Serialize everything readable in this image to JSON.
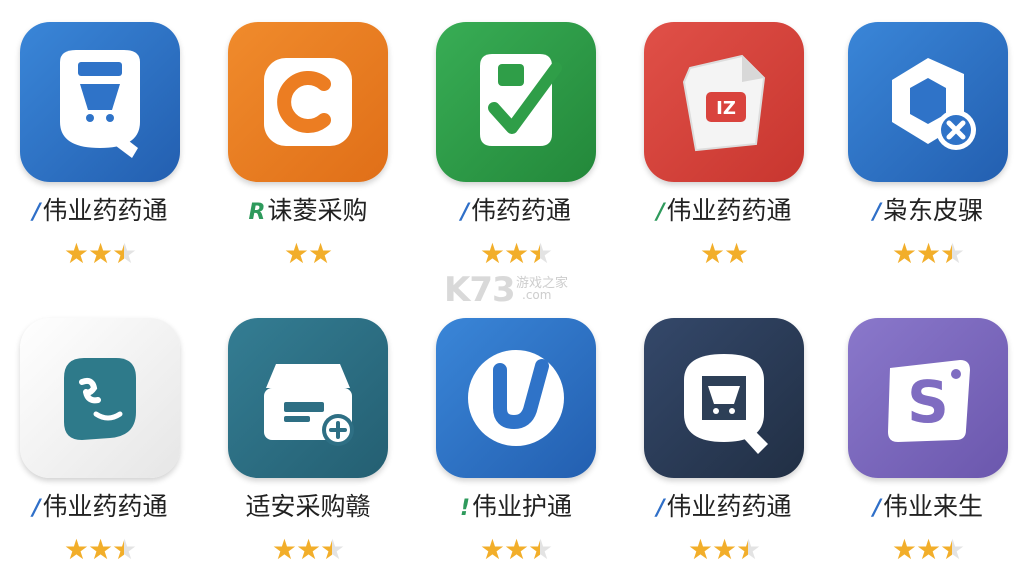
{
  "apps": [
    {
      "name": "伟业药药通",
      "mark": "/",
      "mark_color": "#2f6fc8",
      "rating": 2.5,
      "icon": "q-bag-icon",
      "bg": "#2f73c8"
    },
    {
      "name": "诔菱采购",
      "mark": "R",
      "mark_color": "#2e9a5c",
      "rating": 2,
      "icon": "c-letter-icon",
      "bg": "#ec7d22"
    },
    {
      "name": "伟药药通",
      "mark": "/",
      "mark_color": "#2f6fc8",
      "rating": 2.5,
      "icon": "bag-check-icon",
      "bg": "#2f9e48"
    },
    {
      "name": "伟业药药通",
      "mark": "/",
      "mark_color": "#2e9a5c",
      "rating": 2,
      "icon": "cube-tag-icon",
      "bg": "#d9433d"
    },
    {
      "name": "枭东皮骒",
      "mark": "/",
      "mark_color": "#2f6fc8",
      "rating": 2.5,
      "icon": "q-plus-icon",
      "bg": "#2f73c8"
    },
    {
      "name": "伟业药药通",
      "mark": "/",
      "mark_color": "#2f6fc8",
      "rating": 2.5,
      "icon": "speech-face-icon",
      "bg": "#f2f2f2"
    },
    {
      "name": "适安采购赣",
      "mark": "",
      "mark_color": "#2f6fc8",
      "rating": 2.5,
      "icon": "printer-plus-icon",
      "bg": "#2e6f84"
    },
    {
      "name": "伟业护通",
      "mark": "!",
      "mark_color": "#2e9a5c",
      "rating": 2.5,
      "icon": "u-check-icon",
      "bg": "#2f73c8"
    },
    {
      "name": "伟业药药通",
      "mark": "/",
      "mark_color": "#2f6fc8",
      "rating": 2.5,
      "icon": "q-cart-icon",
      "bg": "#2d3f57"
    },
    {
      "name": "伟业来生",
      "mark": "/",
      "mark_color": "#2f6fc8",
      "rating": 2.5,
      "icon": "s-letter-icon",
      "bg": "#7f6cc1"
    }
  ],
  "watermark": {
    "logo": "K73",
    "text_cn": "游戏之家",
    "text_com": ".com"
  }
}
